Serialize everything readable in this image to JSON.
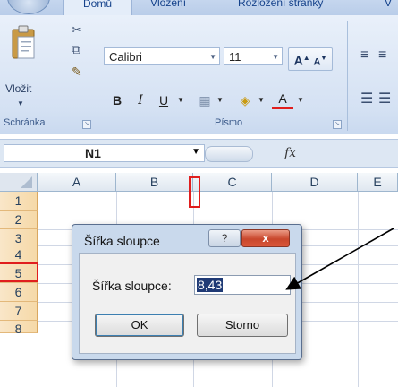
{
  "ribbon": {
    "tabs": [
      "Domů",
      "Vložení",
      "Rozložení stránky",
      "V"
    ],
    "clipboard": {
      "paste_label": "Vložit",
      "group_title": "Schránka"
    },
    "font": {
      "font_name": "Calibri",
      "font_size": "11",
      "group_title": "Písmo",
      "bold": "B",
      "italic": "I",
      "underline": "U",
      "grow": "A",
      "shrink": "A"
    }
  },
  "formula_bar": {
    "name_box": "N1",
    "fx_label": "fx"
  },
  "sheet": {
    "columns": [
      "A",
      "B",
      "C",
      "D",
      "E"
    ],
    "rows": [
      "1",
      "2",
      "3",
      "4",
      "5",
      "6",
      "7",
      "8"
    ]
  },
  "dialog": {
    "title": "Šířka sloupce",
    "help": "?",
    "close": "x",
    "field_label": "Šířka sloupce:",
    "field_value": "8,43",
    "ok": "OK",
    "cancel": "Storno"
  },
  "colors": {
    "highlight": "#e01e1e",
    "ribbon": "#d4e1f3",
    "row_header": "#f6d9a8"
  }
}
